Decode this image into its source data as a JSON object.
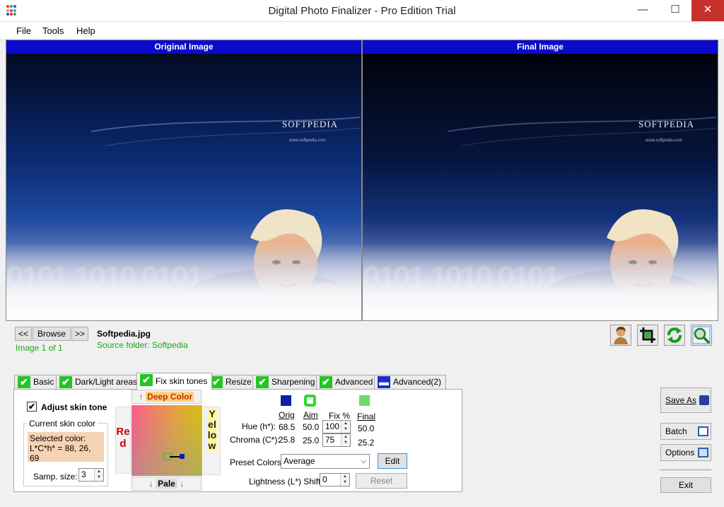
{
  "window": {
    "title": "Digital Photo Finalizer - Pro Edition Trial",
    "minimize": "—",
    "maximize": "☐",
    "close": "✕"
  },
  "menu": [
    "File",
    "Tools",
    "Help"
  ],
  "panes": {
    "original_label": "Original Image",
    "final_label": "Final Image",
    "logo_text": "SOFTPEDIA",
    "logo_url": "www.softpedia.com"
  },
  "nav": {
    "prev": "<<",
    "browse": "Browse",
    "next": ">>",
    "filename": "Softpedia.jpg",
    "image_counter": "Image 1 of 1",
    "source_folder": "Source folder: Softpedia"
  },
  "toolbar_icons": [
    "portrait-icon",
    "crop-icon",
    "rotate-icon",
    "zoom-icon"
  ],
  "tabs": [
    {
      "label": "Basic",
      "checked": true
    },
    {
      "label": "Dark/Light areas",
      "checked": true
    },
    {
      "label": "Fix skin tones",
      "checked": true,
      "active": true
    },
    {
      "label": "Resize",
      "checked": true
    },
    {
      "label": "Sharpening",
      "checked": true
    },
    {
      "label": "Advanced",
      "checked": true
    },
    {
      "label": "Advanced(2)",
      "checked": false
    }
  ],
  "skin": {
    "adjust_label": "Adjust skin tone",
    "adjust_checked": true,
    "group_label": "Current skin color",
    "selected_label": "Selected color:",
    "selected_value": "L*C*h* = 88, 26, 69",
    "samp_label": "Samp. size:",
    "samp_value": "3",
    "picker": {
      "top": "Deep Color",
      "bottom": "Pale",
      "left": "Red",
      "right": "Yellow"
    },
    "col_orig": "Orig",
    "col_aim": "Aim",
    "col_fix": "Fix %",
    "col_final": "Final",
    "hue_label": "Hue (h*):",
    "hue_orig": "68.5",
    "hue_aim": "50.0",
    "hue_fix": "100",
    "hue_final": "50.0",
    "chroma_label": "Chroma (C*):",
    "chroma_orig": "25.8",
    "chroma_aim": "25.0",
    "chroma_fix": "75",
    "chroma_final": "25.2",
    "preset_label": "Preset Colors:",
    "preset_value": "Average",
    "edit_button": "Edit",
    "lightness_label": "Lightness (L*) Shift:",
    "lightness_value": "0",
    "reset_button": "Reset",
    "colors": {
      "orig": "#0b1fa8",
      "aim": "#33d633",
      "final": "#6fd86f",
      "selected_bg": "#f7d3b5"
    }
  },
  "right_buttons": {
    "save_as": "Save As",
    "batch": "Batch",
    "options": "Options",
    "exit": "Exit"
  }
}
